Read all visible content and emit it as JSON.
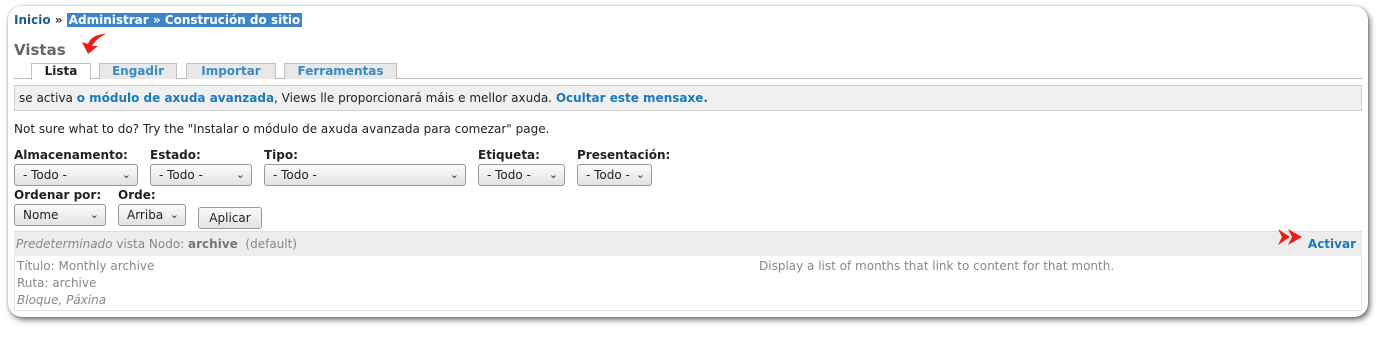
{
  "breadcrumb": {
    "home": "Inicio",
    "separator": "»",
    "highlighted": "Administrar » Construción do sitio"
  },
  "page_title": "Vistas",
  "tabs": [
    {
      "label": "Lista",
      "active": true
    },
    {
      "label": "Engadir",
      "active": false
    },
    {
      "label": "Importar",
      "active": false
    },
    {
      "label": "Ferramentas",
      "active": false
    }
  ],
  "notice": {
    "prefix": "se activa ",
    "link1": "o módulo de axuda avanzada",
    "middle": ", Views lle proporcionará máis e mellor axuda. ",
    "link2": "Ocultar este mensaxe."
  },
  "help_text": "Not sure what to do? Try the \"Instalar o módulo de axuda avanzada para comezar\" page.",
  "filters": {
    "storage": {
      "label": "Almacenamento:",
      "value": "- Todo -"
    },
    "status": {
      "label": "Estado:",
      "value": "- Todo -"
    },
    "type": {
      "label": "Tipo:",
      "value": "- Todo -"
    },
    "tag": {
      "label": "Etiqueta:",
      "value": "- Todo -"
    },
    "display": {
      "label": "Presentación:",
      "value": "- Todo -"
    },
    "sort_by": {
      "label": "Ordenar por:",
      "value": "Nome"
    },
    "order": {
      "label": "Orde:",
      "value": "Arriba"
    },
    "apply_label": "Aplicar"
  },
  "view": {
    "storage_type": "Predeterminado",
    "header_middle": " vista Nodo: ",
    "name": "archive",
    "tag": "(default)",
    "enable_label": "Activar",
    "title_line": "Título: Monthly archive",
    "path_line": "Ruta: archive",
    "displays_line": "Bloque, Páxina",
    "description": "Display a list of months that link to content for that month."
  },
  "colors": {
    "link": "#1a7ab8",
    "highlight": "#3e84c9",
    "arrow": "#e8201a"
  },
  "icons": {
    "annotation_arrow_left": "curved-arrow-icon",
    "annotation_arrow_right": "double-arrow-icon",
    "select_chevron": "chevron-down-icon"
  }
}
